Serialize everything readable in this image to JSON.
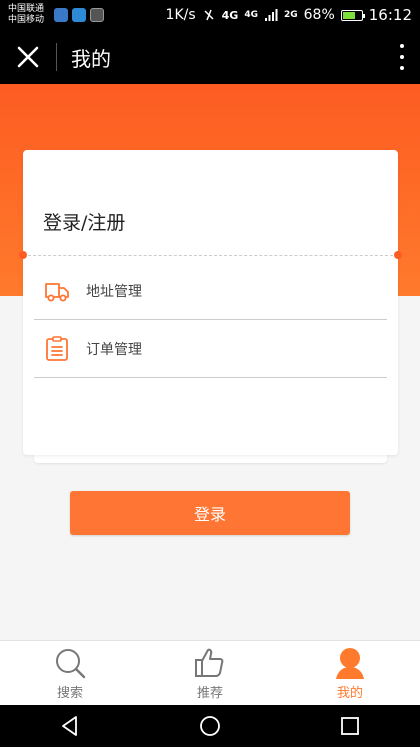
{
  "status_bar": {
    "carrier_1": "中国联通",
    "carrier_2": "中国移动",
    "net_speed": "1K/s",
    "net_4g": "4G",
    "net_4g_small": "4G",
    "net_2g": "2G",
    "battery_percent": "68%",
    "battery_level": 0.68,
    "time": "16:12"
  },
  "header": {
    "title": "我的",
    "close_icon": "close-icon",
    "more_icon": "more-vertical-icon"
  },
  "card": {
    "login_register": "登录/注册",
    "menu": [
      {
        "label": "地址管理",
        "icon": "truck-icon"
      },
      {
        "label": "订单管理",
        "icon": "clipboard-icon"
      }
    ]
  },
  "login_button": "登录",
  "tabs": [
    {
      "label": "搜索",
      "icon": "search-icon",
      "active": false
    },
    {
      "label": "推荐",
      "icon": "thumbs-up-icon",
      "active": false
    },
    {
      "label": "我的",
      "icon": "user-icon",
      "active": true
    }
  ],
  "colors": {
    "accent": "#ff7533",
    "header_gradient_top": "#fd5c22",
    "header_gradient_bottom": "#ff7a2c"
  }
}
